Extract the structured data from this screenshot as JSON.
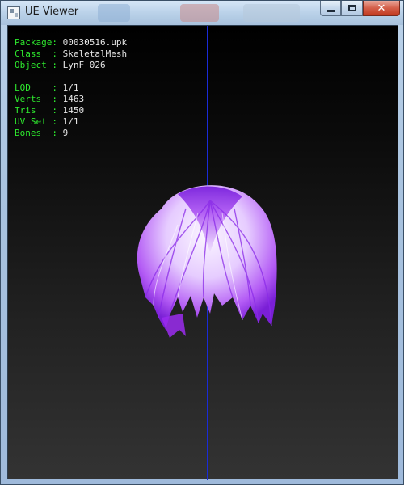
{
  "window": {
    "title": "UE Viewer",
    "buttons": {
      "minimize": "minimize",
      "maximize": "maximize",
      "close": "✕"
    }
  },
  "info": {
    "rows": [
      {
        "key": "Package:",
        "value": "00030516.upk"
      },
      {
        "key": "Class  :",
        "value": "SkeletalMesh"
      },
      {
        "key": "Object :",
        "value": "LynF_026"
      },
      {
        "key": "LOD    :",
        "value": "1/1"
      },
      {
        "key": "Verts  :",
        "value": "1463"
      },
      {
        "key": "Tris   :",
        "value": "1450"
      },
      {
        "key": "UV Set :",
        "value": "1/1"
      },
      {
        "key": "Bones  :",
        "value": "9"
      }
    ]
  },
  "colors": {
    "label": "#2ee82e",
    "value": "#e6e6e6",
    "axis": "#1a2bd8",
    "hair_primary": "#9b2cf0",
    "hair_highlight": "#f3eaff"
  },
  "icons": {
    "app": "app-icon",
    "close": "close-icon",
    "minimize": "minimize-icon",
    "maximize": "maximize-icon"
  }
}
